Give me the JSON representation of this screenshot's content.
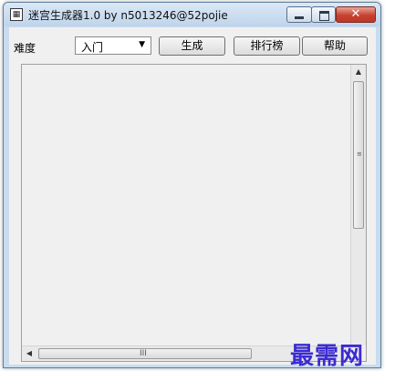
{
  "window": {
    "title": "迷宫生成器1.0 by n5013246@52pojie",
    "icon": "maze-app-icon"
  },
  "toolbar": {
    "difficulty_label": "难度",
    "difficulty_selected": "入门",
    "generate_label": "生成",
    "leaderboard_label": "排行榜",
    "help_label": "帮助"
  },
  "scrollbars": {
    "vertical_glyphs": {
      "up": "▲",
      "grip": "≡"
    },
    "horizontal_glyphs": {
      "left": "◀",
      "grip": "III"
    }
  },
  "watermark": "最需网",
  "colors": {
    "close_button": "#c7422e",
    "watermark": "#3b2bd1"
  }
}
